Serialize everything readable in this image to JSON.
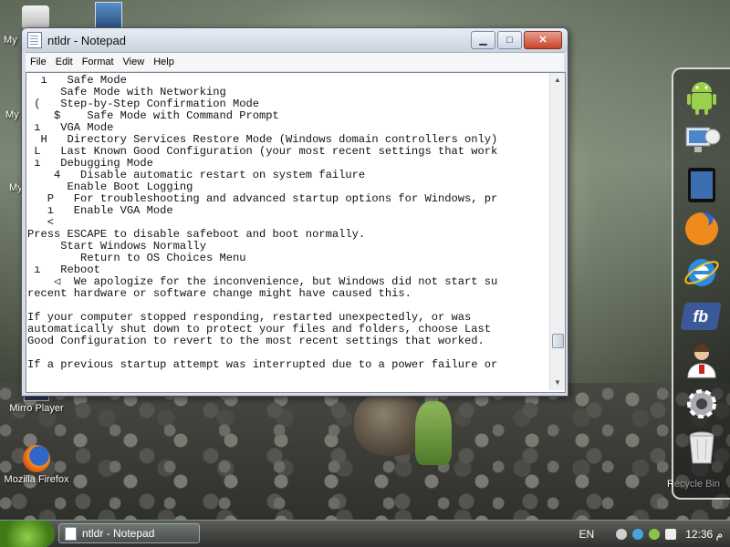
{
  "desktop": {
    "icons": [
      {
        "label": "My"
      },
      {
        "label": "My"
      },
      {
        "label": "My"
      },
      {
        "label": "Mirro Player"
      },
      {
        "label": "Mozilla Firefox"
      },
      {
        "label": "Recycle Bin"
      }
    ]
  },
  "window": {
    "title": "ntldr - Notepad",
    "buttons": {
      "minimize": "▁",
      "maximize": "□",
      "close": "✕"
    },
    "menu": [
      "File",
      "Edit",
      "Format",
      "View",
      "Help"
    ],
    "lines": [
      "  ı   Safe Mode",
      "     Safe Mode with Networking",
      " (   Step-by-Step Confirmation Mode",
      "    $    Safe Mode with Command Prompt",
      " ı   VGA Mode",
      "  H   Directory Services Restore Mode (Windows domain controllers only)",
      " L   Last Known Good Configuration (your most recent settings that work",
      " ı   Debugging Mode",
      "    4   Disable automatic restart on system failure",
      "      Enable Boot Logging",
      "   P   For troubleshooting and advanced startup options for Windows, pr",
      "   ı   Enable VGA Mode",
      "   <",
      "Press ESCAPE to disable safeboot and boot normally.",
      "     Start Windows Normally",
      "        Return to OS Choices Menu",
      " ı   Reboot",
      "    ◁  We apologize for the inconvenience, but Windows did not start su",
      "recent hardware or software change might have caused this.",
      "",
      "If your computer stopped responding, restarted unexpectedly, or was",
      "automatically shut down to protect your files and folders, choose Last",
      "Good Configuration to revert to the most recent settings that worked.",
      "",
      "If a previous startup attempt was interrupted due to a power failure or"
    ]
  },
  "dock": {
    "items": [
      "android-icon",
      "network-computer-icon",
      "tablet-icon",
      "firefox-icon",
      "internet-explorer-icon",
      "facebook-icon",
      "support-person-icon",
      "settings-gear-icon",
      "recycle-bin-icon"
    ],
    "fb_text": "fb"
  },
  "taskbar": {
    "task_label": "ntldr - Notepad",
    "language": "EN",
    "time": "12:36 م"
  },
  "colors": {
    "accent": "#3f7a16",
    "window_frame": "#d7dde6",
    "close": "#c8432b"
  }
}
